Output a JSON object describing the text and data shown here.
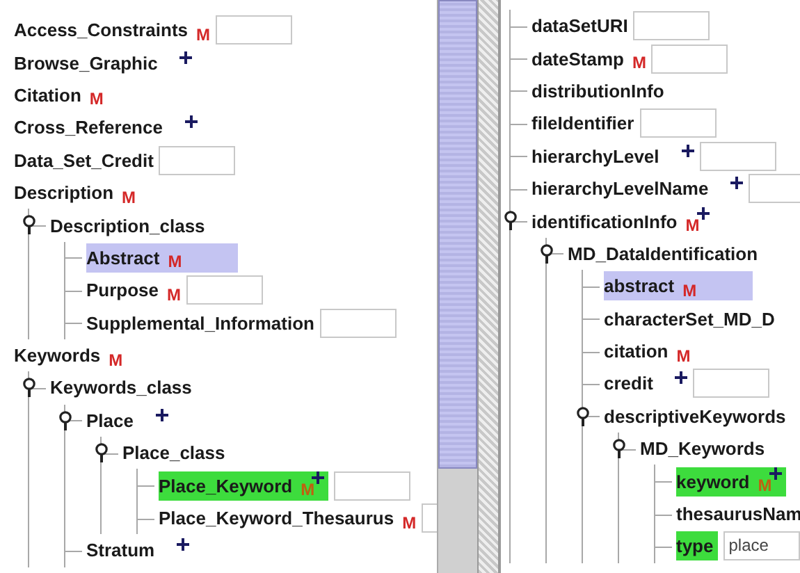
{
  "trees": [
    {
      "nodes": [
        {
          "label": "Access_Constraints",
          "badge": "M",
          "field": true
        },
        {
          "label": "Browse_Graphic",
          "plus": true
        },
        {
          "label": "Citation",
          "badge": "M"
        },
        {
          "label": "Cross_Reference",
          "plus": true
        },
        {
          "label": "Data_Set_Credit",
          "field": true
        },
        {
          "label": "Description",
          "badge": "M",
          "children": [
            {
              "label": "Description_class",
              "expanded": true,
              "children": [
                {
                  "label": "Abstract",
                  "badge": "M",
                  "color": "#c4c4f2"
                },
                {
                  "label": "Purpose",
                  "badge": "M",
                  "field": true
                },
                {
                  "label": "Supplemental_Information",
                  "field": true
                }
              ]
            }
          ]
        },
        {
          "label": "Keywords",
          "badge": "M",
          "children": [
            {
              "label": "Keywords_class",
              "expanded": true,
              "children": [
                {
                  "label": "Place",
                  "plus": true,
                  "expanded": true,
                  "children": [
                    {
                      "label": "Place_class",
                      "expanded": true,
                      "children": [
                        {
                          "label": "Place_Keyword",
                          "badge": "M",
                          "plus": true,
                          "color": "#3ddc3d",
                          "field": true
                        },
                        {
                          "label": "Place_Keyword_Thesaurus",
                          "badge": "M",
                          "field": true
                        }
                      ]
                    }
                  ]
                },
                {
                  "label": "Stratum",
                  "plus": true
                }
              ]
            }
          ]
        }
      ]
    },
    {
      "nodes": [
        {
          "label": "dataSetURI",
          "field": true
        },
        {
          "label": "dateStamp",
          "badge": "M",
          "field": true
        },
        {
          "label": "distributionInfo"
        },
        {
          "label": "fileIdentifier",
          "field": true
        },
        {
          "label": "hierarchyLevel",
          "plus": true,
          "field": true
        },
        {
          "label": "hierarchyLevelName",
          "plus": true,
          "field": true
        },
        {
          "label": "identificationInfo",
          "badge": "M",
          "plus": true,
          "expanded": true,
          "children": [
            {
              "label": "MD_DataIdentification",
              "expanded": true,
              "children": [
                {
                  "label": "abstract",
                  "badge": "M",
                  "color": "#c4c4f2"
                },
                {
                  "label": "characterSet_MD_D"
                },
                {
                  "label": "citation",
                  "badge": "M"
                },
                {
                  "label": "credit",
                  "plus": true,
                  "field": true
                },
                {
                  "label": "descriptiveKeywords",
                  "expanded": true,
                  "children": [
                    {
                      "label": "MD_Keywords",
                      "expanded": true,
                      "children": [
                        {
                          "label": "keyword",
                          "badge": "M",
                          "plus": true,
                          "color": "#3ddc3d"
                        },
                        {
                          "label": "thesaurusNam"
                        },
                        {
                          "label": "type",
                          "color": "#3ddc3d",
                          "value": "place"
                        }
                      ]
                    }
                  ]
                }
              ]
            }
          ]
        }
      ]
    }
  ]
}
